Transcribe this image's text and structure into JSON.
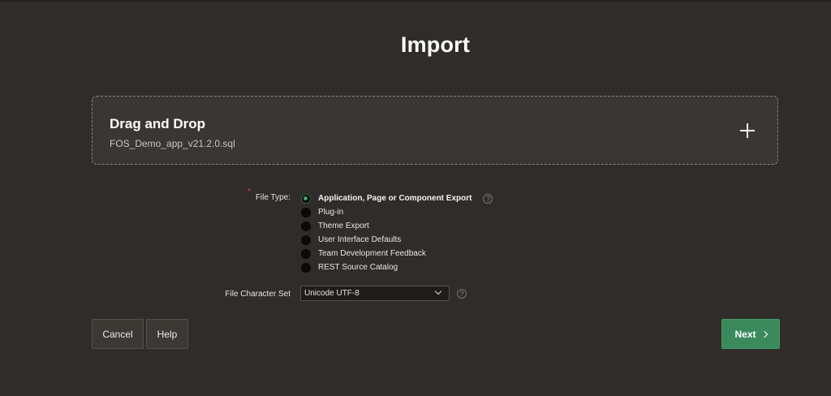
{
  "page": {
    "title": "Import"
  },
  "dropzone": {
    "title": "Drag and Drop",
    "file_name": "FOS_Demo_app_v21.2.0.sql",
    "plus_icon": "plus-icon"
  },
  "file_type": {
    "label": "File Type:",
    "required_marker": "*",
    "options": [
      {
        "label": "Application, Page or Component Export",
        "selected": true
      },
      {
        "label": "Plug-in",
        "selected": false
      },
      {
        "label": "Theme Export",
        "selected": false
      },
      {
        "label": "User Interface Defaults",
        "selected": false
      },
      {
        "label": "Team Development Feedback",
        "selected": false
      },
      {
        "label": "REST Source Catalog",
        "selected": false
      }
    ],
    "help_icon": "?"
  },
  "charset": {
    "label": "File Character Set",
    "value": "Unicode UTF-8",
    "help_icon": "?"
  },
  "buttons": {
    "cancel": "Cancel",
    "help": "Help",
    "next": "Next"
  },
  "colors": {
    "background": "#2f2c29",
    "dropzone_bg": "#3a3633",
    "primary": "#3a8a5c",
    "required": "#e0493a"
  }
}
